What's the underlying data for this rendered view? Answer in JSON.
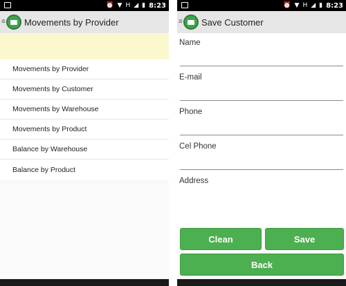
{
  "status_bar": {
    "time": "8:23",
    "network_label": "H"
  },
  "left": {
    "title": "Movements by Provider",
    "menu_items": [
      {
        "label": "Movements by Provider"
      },
      {
        "label": "Movements by Customer"
      },
      {
        "label": "Movements by Warehouse"
      },
      {
        "label": "Movements by Product"
      },
      {
        "label": "Balance by Warehouse"
      },
      {
        "label": "Balance by Product"
      }
    ]
  },
  "right": {
    "title": "Save Customer",
    "fields": {
      "name": {
        "label": "Name",
        "value": ""
      },
      "email": {
        "label": "E-mail",
        "value": ""
      },
      "phone": {
        "label": "Phone",
        "value": ""
      },
      "cel_phone": {
        "label": "Cel Phone",
        "value": ""
      },
      "address": {
        "label": "Address",
        "value": ""
      }
    },
    "buttons": {
      "clean": "Clean",
      "save": "Save",
      "back": "Back"
    }
  },
  "colors": {
    "accent": "#4caf50",
    "banner": "#fbf8cf",
    "action_bar": "#e6e6e6"
  },
  "icons": [
    "menu-icon",
    "app-basket-icon",
    "notification-icon",
    "alarm-icon",
    "wifi-icon",
    "signal-icon",
    "battery-icon"
  ]
}
